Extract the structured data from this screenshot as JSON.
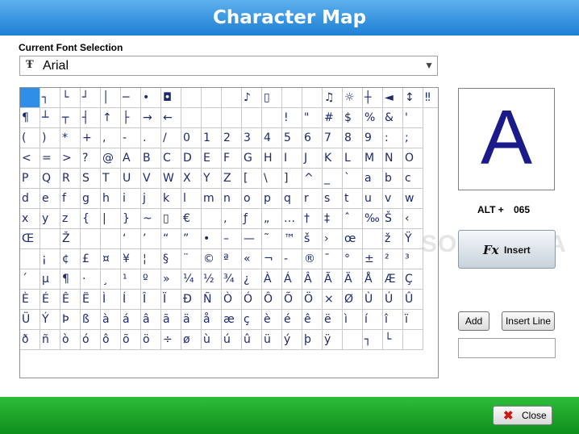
{
  "window": {
    "title": "Character Map"
  },
  "font": {
    "label": "Current Font Selection",
    "selected": "Arial",
    "icon": "truetype-font-icon"
  },
  "grid": {
    "rows": [
      [
        "",
        "┐",
        "└",
        "┘",
        "│",
        "─",
        "•",
        "◘",
        "",
        "",
        "",
        "♪",
        "▯",
        "",
        "",
        "♫",
        "☼",
        "┼",
        "◄",
        "↕",
        "‼"
      ],
      [
        "¶",
        "┴",
        "┬",
        "┤",
        "↑",
        "├",
        "→",
        "←",
        "",
        "",
        "",
        "",
        "",
        "!",
        "\"",
        "#",
        "$",
        "%",
        "&",
        "'"
      ],
      [
        "(",
        ")",
        "*",
        "+",
        ",",
        "-",
        ".",
        "/",
        "0",
        "1",
        "2",
        "3",
        "4",
        "5",
        "6",
        "7",
        "8",
        "9",
        ":",
        ";"
      ],
      [
        "<",
        "=",
        ">",
        "?",
        "@",
        "A",
        "B",
        "C",
        "D",
        "E",
        "F",
        "G",
        "H",
        "I",
        "J",
        "K",
        "L",
        "M",
        "N",
        "O"
      ],
      [
        "P",
        "Q",
        "R",
        "S",
        "T",
        "U",
        "V",
        "W",
        "X",
        "Y",
        "Z",
        "[",
        "\\",
        "]",
        "^",
        "_",
        "`",
        "a",
        "b",
        "c"
      ],
      [
        "d",
        "e",
        "f",
        "g",
        "h",
        "i",
        "j",
        "k",
        "l",
        "m",
        "n",
        "o",
        "p",
        "q",
        "r",
        "s",
        "t",
        "u",
        "v",
        "w"
      ],
      [
        "x",
        "y",
        "z",
        "{",
        "|",
        "}",
        "~",
        "▯",
        "€",
        "",
        "‚",
        "ƒ",
        "„",
        "…",
        "†",
        "‡",
        "ˆ",
        "‰",
        "Š",
        "‹"
      ],
      [
        "Œ",
        "",
        "Ž",
        "",
        "",
        "‘",
        "’",
        "“",
        "”",
        "•",
        "–",
        "—",
        "˜",
        "™",
        "š",
        "›",
        "œ",
        "",
        "ž",
        "Ÿ"
      ],
      [
        "",
        "¡",
        "¢",
        "£",
        "¤",
        "¥",
        "¦",
        "§",
        "¨",
        "©",
        "ª",
        "«",
        "¬",
        "-",
        "®",
        "¯",
        "°",
        "±",
        "²",
        "³"
      ],
      [
        "´",
        "µ",
        "¶",
        "·",
        "¸",
        "¹",
        "º",
        "»",
        "¼",
        "½",
        "¾",
        "¿",
        "À",
        "Á",
        "Â",
        "Ã",
        "Ä",
        "Å",
        "Æ",
        "Ç"
      ],
      [
        "È",
        "É",
        "Ê",
        "Ë",
        "Ì",
        "Í",
        "Î",
        "Ï",
        "Ð",
        "Ñ",
        "Ò",
        "Ó",
        "Ô",
        "Õ",
        "Ö",
        "×",
        "Ø",
        "Ù",
        "Ú",
        "Û"
      ],
      [
        "Ü",
        "Ý",
        "Þ",
        "ß",
        "à",
        "á",
        "â",
        "ã",
        "ä",
        "å",
        "æ",
        "ç",
        "è",
        "é",
        "ê",
        "ë",
        "ì",
        "í",
        "î",
        "ï"
      ],
      [
        "ð",
        "ñ",
        "ò",
        "ó",
        "ô",
        "õ",
        "ö",
        "÷",
        "ø",
        "ù",
        "ú",
        "û",
        "ü",
        "ý",
        "þ",
        "ÿ",
        "",
        "┐",
        "└",
        ""
      ]
    ],
    "selected": [
      0,
      0
    ]
  },
  "preview": {
    "char": "A",
    "alt_label": "ALT +",
    "alt_code": "065"
  },
  "buttons": {
    "insert": "Insert",
    "add": "Add",
    "insert_line": "Insert Line",
    "close": "Close"
  },
  "watermark": "SOFTPEDIA",
  "colors": {
    "title_bar": "#1f7fd3",
    "footer": "#0e8f1c",
    "selected_cell": "#2e8ee8",
    "glyph": "#1c2a70",
    "preview_glyph": "#1a1a8a",
    "close_icon": "#d01515"
  }
}
